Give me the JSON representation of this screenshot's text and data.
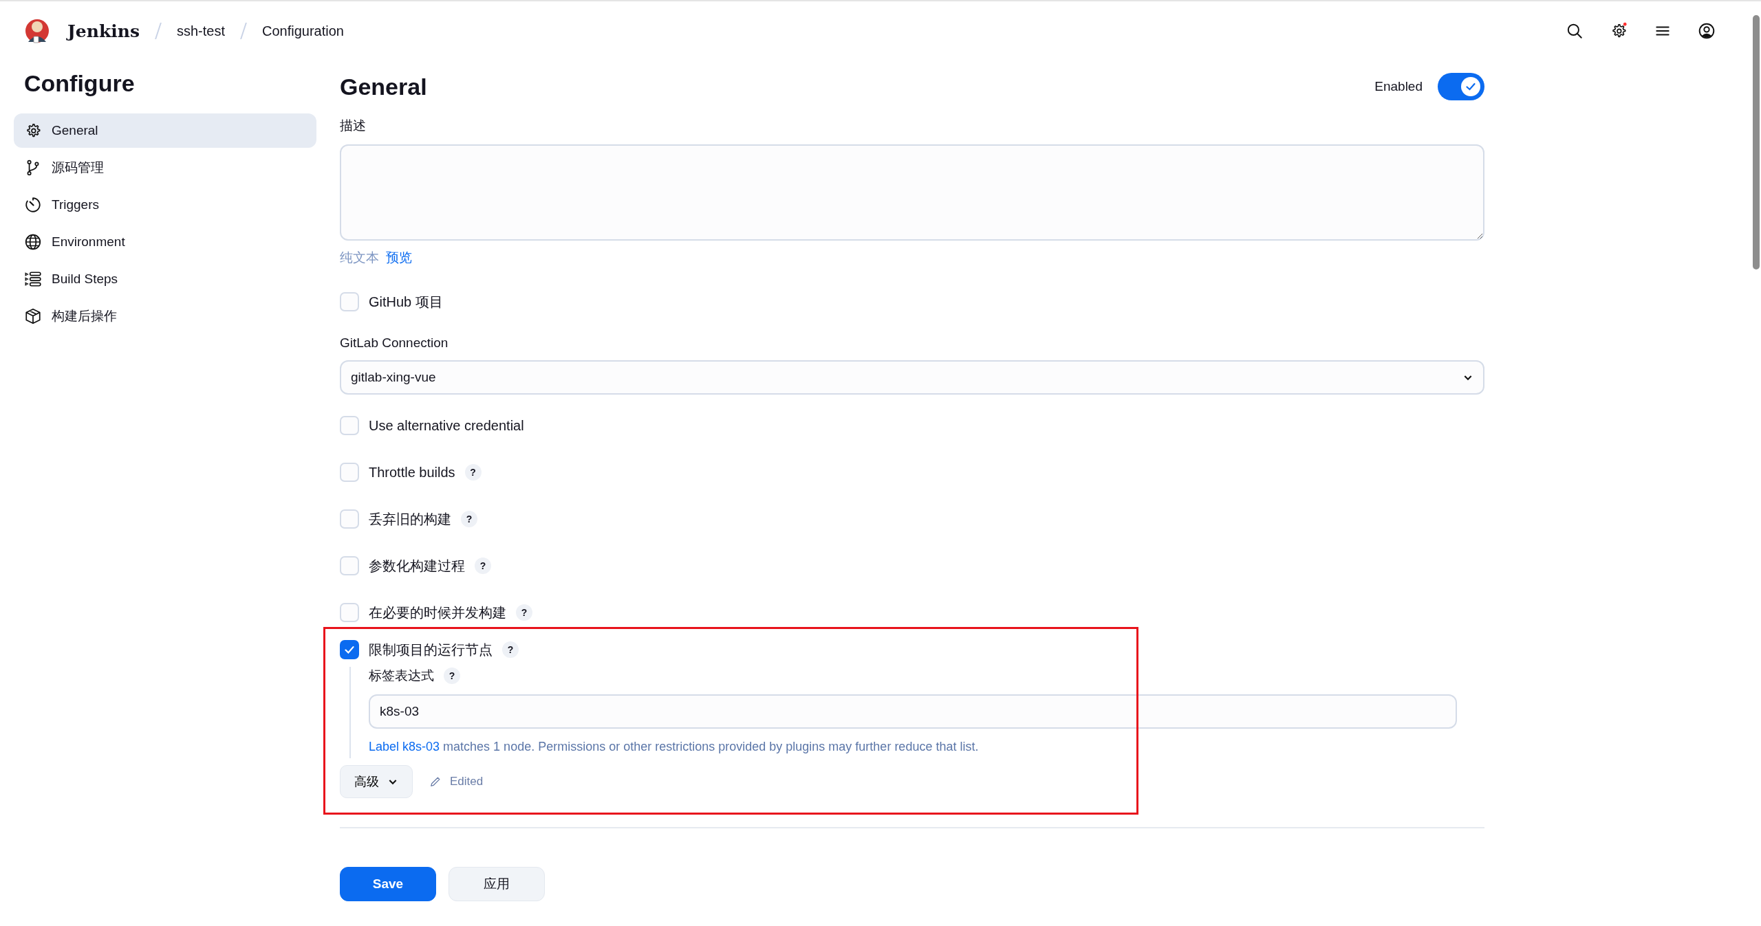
{
  "header": {
    "app_name": "Jenkins",
    "breadcrumbs": [
      {
        "label": "ssh-test"
      },
      {
        "label": "Configuration"
      }
    ],
    "settings_alert": true
  },
  "sidebar": {
    "title": "Configure",
    "items": [
      {
        "label": "General",
        "selected": true
      },
      {
        "label": "源码管理",
        "selected": false
      },
      {
        "label": "Triggers",
        "selected": false
      },
      {
        "label": "Environment",
        "selected": false
      },
      {
        "label": "Build Steps",
        "selected": false
      },
      {
        "label": "构建后操作",
        "selected": false
      }
    ]
  },
  "section": {
    "title": "General",
    "enabled": {
      "label": "Enabled",
      "on": true
    },
    "description": {
      "label": "描述",
      "formats": [
        {
          "label": "纯文本",
          "selected": true
        },
        {
          "label": "预览",
          "selected": false
        }
      ]
    },
    "fields": [
      {
        "kind": "checkbox",
        "label": "GitHub 项目",
        "checked": false
      },
      {
        "kind": "select",
        "label": "GitLab Connection",
        "value": "gitlab-xing-vue"
      },
      {
        "kind": "checkbox",
        "label": "Use alternative credential",
        "checked": false
      },
      {
        "kind": "checkbox",
        "label": "Throttle builds",
        "checked": false,
        "help": "?"
      },
      {
        "kind": "checkbox",
        "label": "丢弃旧的构建",
        "checked": false,
        "help": "?"
      },
      {
        "kind": "checkbox",
        "label": "参数化构建过程",
        "checked": false,
        "help": "?"
      },
      {
        "kind": "checkbox",
        "label": "在必要的时候并发构建",
        "checked": false,
        "help": "?"
      },
      {
        "kind": "checkbox",
        "label": "限制项目的运行节点",
        "checked": true,
        "help": "?",
        "highlighted": true,
        "nested": {
          "label": "标签表达式",
          "help": "?",
          "value": "k8s-03",
          "link": "Label k8s-03",
          "message": "matches 1 node. Permissions or other restrictions provided by plugins may further reduce that list."
        },
        "advanced": "高级",
        "status": "Edited"
      }
    ]
  },
  "footer": {
    "buttons": [
      {
        "label": "Save",
        "primary": true
      },
      {
        "label": "应用",
        "primary": false
      }
    ]
  }
}
